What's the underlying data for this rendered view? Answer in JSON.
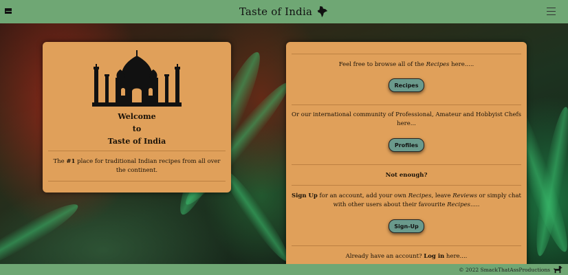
{
  "header": {
    "title": "Taste of India"
  },
  "left_card": {
    "welcome_line1": "Welcome",
    "welcome_line2": "to",
    "welcome_line3": "Taste of India",
    "blurb_pre": "The ",
    "blurb_bold": "#1",
    "blurb_post": " place for traditional Indian recipes from all over the continent."
  },
  "right_card": {
    "browse_pre": "Feel free to browse all of the ",
    "browse_em": "Recipes",
    "browse_post": " here.....",
    "recipes_button": "Recipes",
    "community_text": "Or our international community of Professional, Amateur and Hobbyist Chefs here...",
    "profiles_button": "Profiles",
    "not_enough": "Not enough?",
    "signup_bold": "Sign Up",
    "signup_mid1": " for an account, add your own ",
    "signup_em1": "Recipes",
    "signup_mid2": ", leave ",
    "signup_em2": "Reviews",
    "signup_mid3": " or simply chat with other users about their favourite ",
    "signup_em3": "Recipes",
    "signup_end": ".....",
    "signup_button": "Sign-Up",
    "login_pre": "Already have an account? ",
    "login_bold": "Log in",
    "login_post": " here...."
  },
  "footer": {
    "copyright": "© 2022 SmackThatAssProductions"
  },
  "icons": [
    "mail-icon",
    "india-map-icon",
    "menu-icon",
    "taj-mahal-icon",
    "dog-icon"
  ],
  "colors": {
    "header_green": "#6fa774",
    "card_orange": "#e0a05a",
    "button_teal": "#6a9a8c"
  }
}
